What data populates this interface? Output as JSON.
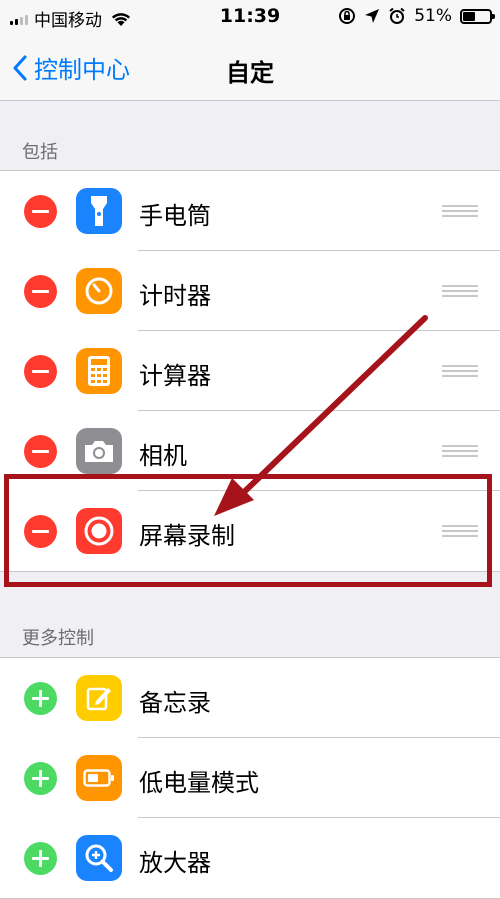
{
  "status_bar": {
    "carrier": "中国移动",
    "time": "11:39",
    "battery_percent": "51%",
    "battery_level": 0.51
  },
  "nav": {
    "back_label": "控制中心",
    "title": "自定"
  },
  "included": {
    "header": "包括",
    "items": [
      {
        "label": "手电筒",
        "icon": "flashlight-icon",
        "color": "#1a84ff"
      },
      {
        "label": "计时器",
        "icon": "timer-icon",
        "color": "#ff9500"
      },
      {
        "label": "计算器",
        "icon": "calculator-icon",
        "color": "#ff9500"
      },
      {
        "label": "相机",
        "icon": "camera-icon",
        "color": "#8e8e93"
      },
      {
        "label": "屏幕录制",
        "icon": "screen-record-icon",
        "color": "#ff3b30"
      }
    ]
  },
  "more": {
    "header": "更多控制",
    "items": [
      {
        "label": "备忘录",
        "icon": "notes-icon",
        "color": "#ffcc00"
      },
      {
        "label": "低电量模式",
        "icon": "low-power-icon",
        "color": "#ff9500"
      },
      {
        "label": "放大器",
        "icon": "magnifier-icon",
        "color": "#1a84ff"
      }
    ]
  },
  "colors": {
    "accent": "#007aff",
    "remove": "#ff3b30",
    "add": "#4cd964",
    "annotation": "#a7131a"
  }
}
